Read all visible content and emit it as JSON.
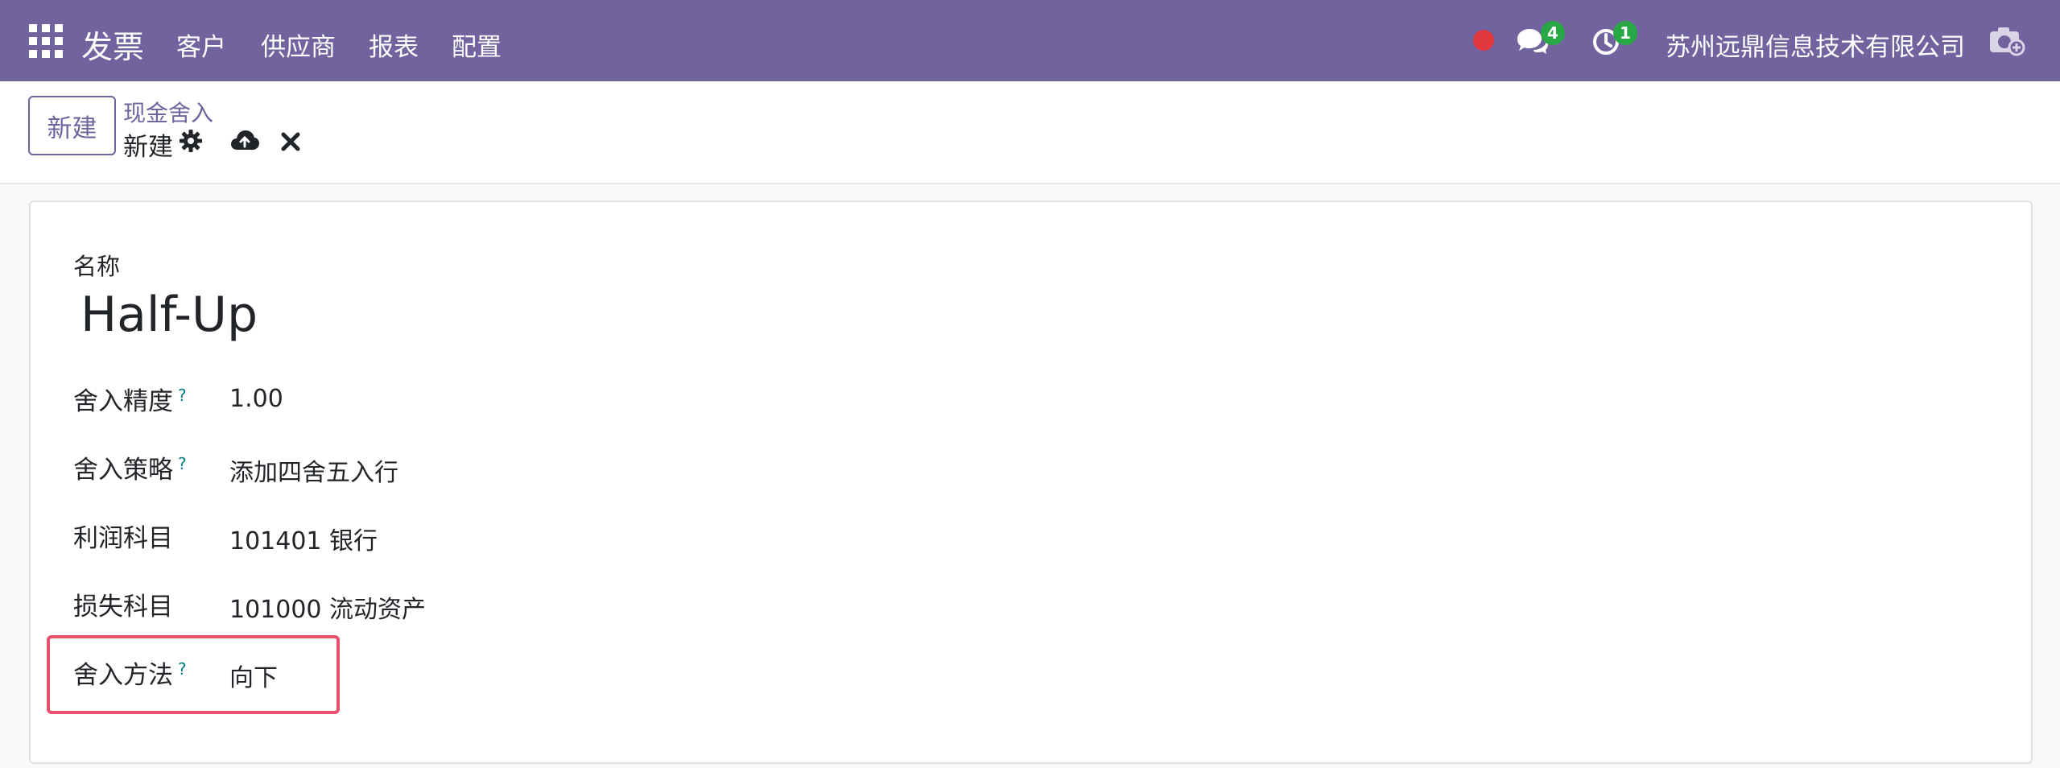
{
  "navbar": {
    "brand": "发票",
    "menu": [
      "客户",
      "供应商",
      "报表",
      "配置"
    ],
    "messages_badge": "4",
    "activities_badge": "1",
    "company": "苏州远鼎信息技术有限公司",
    "icons": {
      "apps": "apps-grid-icon",
      "record": "red-dot-icon",
      "messages": "chat-icon",
      "activities": "clock-icon",
      "camera": "camera-icon"
    }
  },
  "control_panel": {
    "new_button": "新建",
    "breadcrumb_parent": "现金舍入",
    "breadcrumb_current": "新建"
  },
  "form": {
    "name_label": "名称",
    "name_value": "Half-Up",
    "fields": [
      {
        "label": "舍入精度",
        "help": "?",
        "value": "1.00"
      },
      {
        "label": "舍入策略",
        "help": "?",
        "value": "添加四舍五入行"
      },
      {
        "label": "利润科目",
        "help": "",
        "value": "101401 银行"
      },
      {
        "label": "损失科目",
        "help": "",
        "value": "101000 流动资产"
      },
      {
        "label": "舍入方法",
        "help": "?",
        "value": "向下"
      }
    ]
  },
  "colors": {
    "navbar": "#71639e",
    "badge": "#28a745",
    "highlight": "#e8516b",
    "record_dot": "#e0383e"
  }
}
